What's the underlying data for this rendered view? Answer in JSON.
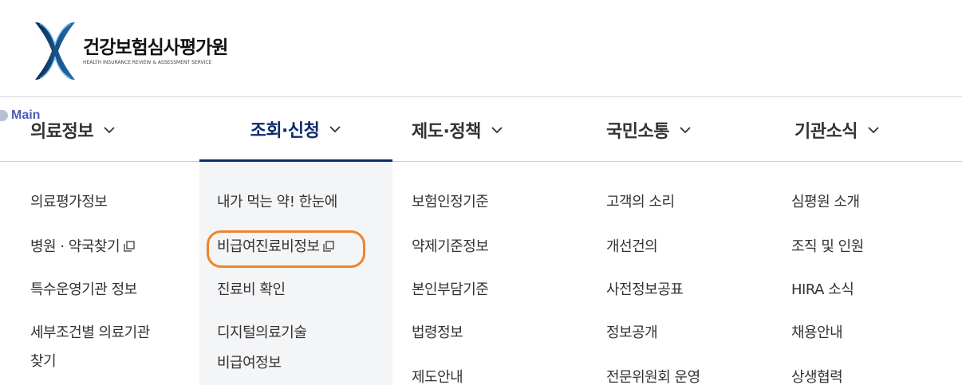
{
  "logo": {
    "korean_name": "건강보험심사평가원",
    "english_name": "HEALTH INSURANCE REVIEW & ASSESSMENT SERVICE"
  },
  "skip_link": {
    "label": "Main"
  },
  "gnb": {
    "items": [
      {
        "label": "의료정보",
        "icon": "chevron-down-icon"
      },
      {
        "label": "조회·신청",
        "icon": "chevron-down-icon"
      },
      {
        "label": "제도·정책",
        "icon": "chevron-down-icon"
      },
      {
        "label": "국민소통",
        "icon": "chevron-down-icon"
      },
      {
        "label": "기관소식",
        "icon": "chevron-down-icon"
      }
    ]
  },
  "submenu": {
    "col1": [
      "의료평가정보",
      "병원 · 약국찾기",
      "특수운영기관 정보",
      "세부조건별 의료기관",
      "찾기"
    ],
    "col2": [
      "내가 먹는 약! 한눈에",
      "비급여진료비정보",
      "진료비 확인",
      "디지털의료기술",
      "비급여정보"
    ],
    "col3": [
      "보험인정기준",
      "약제기준정보",
      "본인부담기준",
      "법령정보",
      "제도안내"
    ],
    "col4": [
      "고객의 소리",
      "개선건의",
      "사전정보공표",
      "정보공개",
      "전문위원회 운영"
    ],
    "col5": [
      "심평원 소개",
      "조직 및 인원",
      "HIRA 소식",
      "채용안내",
      "상생협력"
    ]
  },
  "icons": {
    "external_link": "new-window-icon"
  },
  "colors": {
    "active_nav": "#0d2a6c",
    "highlight": "#f0832a",
    "active_bg": "#f4f5f7"
  }
}
